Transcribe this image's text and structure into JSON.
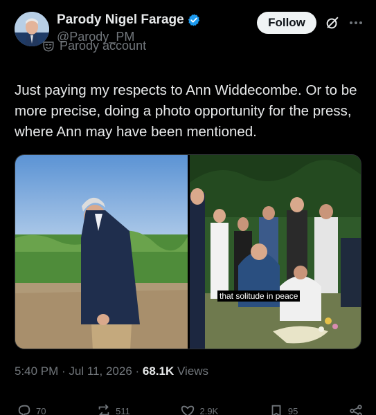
{
  "author": {
    "display_name": "Parody Nigel Farage",
    "handle": "@Parody_PM",
    "label": "Parody account",
    "verified_color": "#1d9bf0"
  },
  "header": {
    "follow_label": "Follow"
  },
  "tweet": {
    "text": "Just paying my respects to Ann Widdecombe. Or to be more precise, doing a photo opportunity for the press, where Ann may have been mentioned.",
    "media_caption": "that solitude in peace"
  },
  "meta": {
    "time": "5:40 PM",
    "separator": " · ",
    "date": "Jul 11, 2026",
    "views_count": "68.1K",
    "views_label": " Views"
  },
  "actions": {
    "replies": "70",
    "reposts": "511",
    "likes": "2.9K",
    "bookmarks": "95"
  },
  "icons": [
    "verified-badge-icon",
    "parody-mask-icon",
    "grok-icon",
    "more-icon",
    "reply-icon",
    "repost-icon",
    "like-icon",
    "bookmark-icon",
    "share-icon"
  ]
}
